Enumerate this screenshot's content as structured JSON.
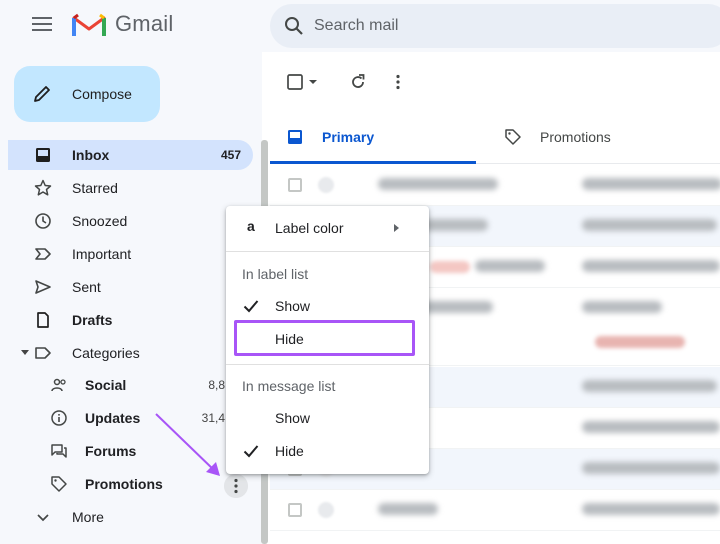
{
  "header": {
    "app_name": "Gmail",
    "menu_icon": "hamburger-menu-icon",
    "logo_icon": "gmail-logo-icon",
    "search": {
      "placeholder": "Search mail",
      "icon": "search-icon"
    }
  },
  "sidebar": {
    "compose_label": "Compose",
    "items": [
      {
        "label": "Inbox",
        "count": "457",
        "icon": "inbox-icon",
        "active": true
      },
      {
        "label": "Starred",
        "icon": "star-icon"
      },
      {
        "label": "Snoozed",
        "icon": "clock-icon"
      },
      {
        "label": "Important",
        "icon": "important-icon"
      },
      {
        "label": "Sent",
        "icon": "send-icon"
      },
      {
        "label": "Drafts",
        "icon": "draft-icon"
      },
      {
        "label": "Categories",
        "icon": "label-icon"
      }
    ],
    "categories": [
      {
        "label": "Social",
        "count": "8,8",
        "icon": "people-icon"
      },
      {
        "label": "Updates",
        "count": "31,4",
        "icon": "info-icon"
      },
      {
        "label": "Forums",
        "icon": "forum-icon"
      },
      {
        "label": "Promotions",
        "icon": "tag-icon"
      }
    ],
    "more_label": "More"
  },
  "main": {
    "tabs": [
      {
        "label": "Primary",
        "icon": "inbox-icon",
        "selected": true
      },
      {
        "label": "Promotions",
        "icon": "tag-icon"
      }
    ]
  },
  "context_menu": {
    "label_color": "Label color",
    "label_color_letter": "a",
    "in_label_list_header": "In label list",
    "label_list_show": "Show",
    "label_list_hide": "Hide",
    "in_message_list_header": "In message list",
    "message_list_show": "Show",
    "message_list_hide": "Hide"
  },
  "colors": {
    "accent": "#0b57d0",
    "highlight": "#a855f7",
    "compose_bg": "#c2e7ff",
    "active_nav": "#d3e3fd"
  }
}
